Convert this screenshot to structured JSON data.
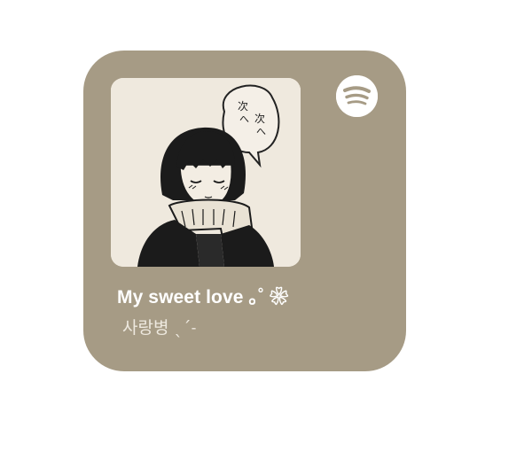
{
  "widget": {
    "background_color": "#a69b85",
    "track_title": "My sweet love ｡˚ ❀",
    "artist": "사랑병 ˎˊ˗",
    "app_icon": "spotify-icon",
    "cover_art": {
      "speech_bubble_text": [
        "次",
        "へ",
        "次",
        "へ"
      ]
    }
  }
}
